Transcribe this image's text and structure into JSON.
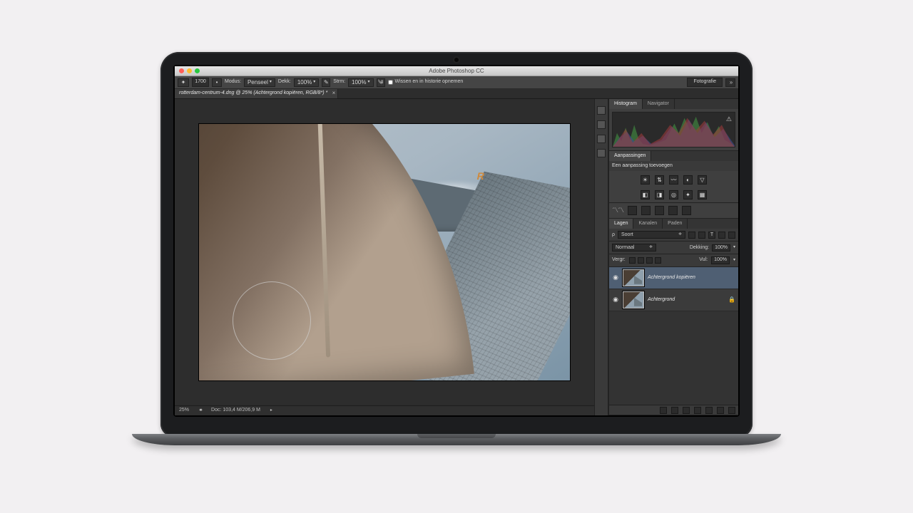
{
  "titlebar": {
    "title": "Adobe Photoshop CC"
  },
  "optionsbar": {
    "brush_size": "1700",
    "label_modus": "Modus:",
    "mode_value": "Penseel",
    "label_dekk": "Dekk:",
    "opacity_value": "100%",
    "label_strm": "Strm:",
    "flow_value": "100%",
    "history_label": "Wissen en in historie opnemen",
    "workspace": "Fotografie"
  },
  "doctab": {
    "label": "rotterdam-centrum-4.dng @ 25% (Achtergrond kopiëren, RGB/8*) *"
  },
  "statusbar": {
    "zoom": "25%",
    "doc": "Doc: 103,4 M/206,9 M"
  },
  "panels": {
    "histogram": {
      "tab_histogram": "Histogram",
      "tab_navigator": "Navigator"
    },
    "adjustments": {
      "title": "Aanpassingen",
      "subtitle": "Een aanpassing toevoegen"
    },
    "layers": {
      "tab_layers": "Lagen",
      "tab_channels": "Kanalen",
      "tab_paths": "Paden",
      "kind_label": "Soort",
      "blend_mode": "Normaal",
      "opacity_label": "Dekking:",
      "opacity_value": "100%",
      "fill_word": "Vul:",
      "fill_value": "100%",
      "lock_label": "Vergr:",
      "items": [
        {
          "name": "Achtergrond kopiëren"
        },
        {
          "name": "Achtergrond"
        }
      ]
    }
  }
}
